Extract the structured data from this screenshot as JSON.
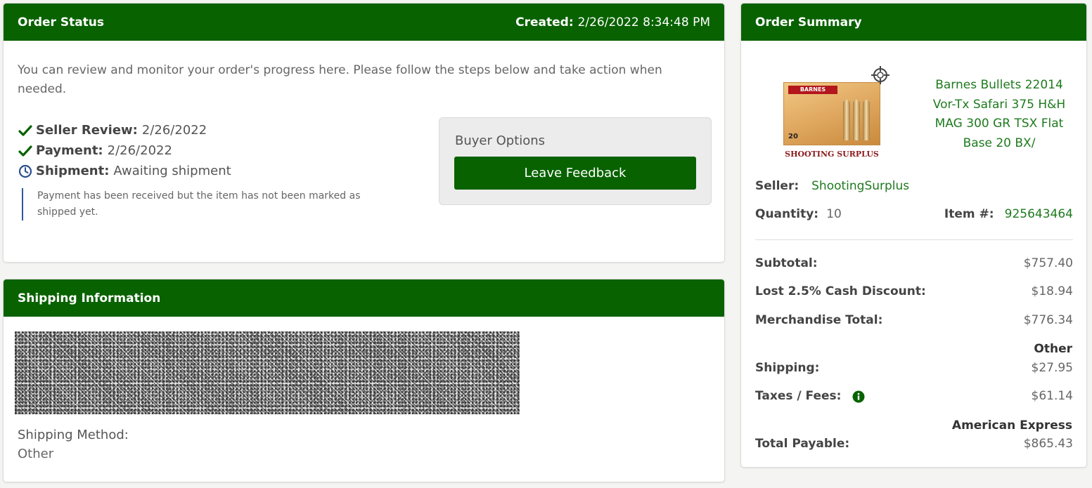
{
  "order_status": {
    "title": "Order Status",
    "created_label": "Created:",
    "created_value": "2/26/2022 8:34:48 PM",
    "intro": "You can review and monitor your order's progress here. Please follow the steps below and take action when needed.",
    "steps": [
      {
        "label": "Seller Review:",
        "value": "2/26/2022",
        "icon": "check-icon"
      },
      {
        "label": "Payment:",
        "value": "2/26/2022",
        "icon": "check-icon"
      },
      {
        "label": "Shipment:",
        "value": "Awaiting shipment",
        "icon": "clock-icon"
      }
    ],
    "note": "Payment has been received but the item has not been marked as shipped yet.",
    "buyer_options": {
      "title": "Buyer Options",
      "feedback_button": "Leave Feedback"
    }
  },
  "shipping_info": {
    "title": "Shipping Information",
    "method_label": "Shipping Method:",
    "method_value": "Other"
  },
  "order_summary": {
    "title": "Order Summary",
    "product": {
      "name": "Barnes Bullets 22014 Vor-Tx Safari 375 H&H MAG 300 GR TSX Flat Base 20 BX/",
      "image_brand": "BARNES",
      "image_count": "20",
      "image_store": "SHOOTING SURPLUS"
    },
    "seller_label": "Seller:",
    "seller_value": "ShootingSurplus",
    "quantity_label": "Quantity:",
    "quantity_value": "10",
    "item_label": "Item #:",
    "item_value": "925643464",
    "subtotal_label": "Subtotal:",
    "subtotal_value": "$757.40",
    "discount_label": "Lost 2.5% Cash Discount:",
    "discount_value": "$18.94",
    "merch_label": "Merchandise Total:",
    "merch_value": "$776.34",
    "shipping_method": "Other",
    "shipping_label": "Shipping:",
    "shipping_value": "$27.95",
    "taxes_label": "Taxes / Fees:",
    "taxes_value": "$61.14",
    "payment_method": "American Express",
    "total_label": "Total Payable:",
    "total_value": "$865.43"
  },
  "colors": {
    "header_green": "#086200",
    "link_green": "#1e7a1e",
    "note_border_blue": "#2a5a9b"
  }
}
